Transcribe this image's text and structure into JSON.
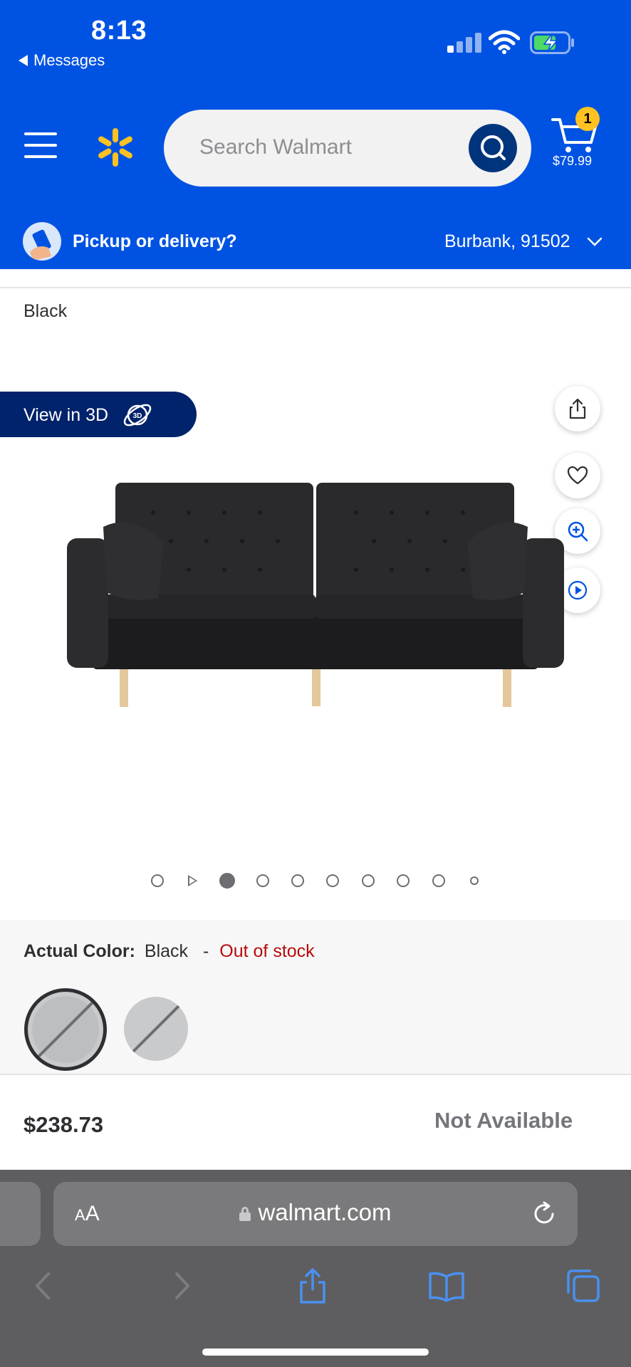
{
  "status_bar": {
    "time": "8:13",
    "back_label": "Messages"
  },
  "header": {
    "search_placeholder": "Search Walmart",
    "cart_count": "1",
    "cart_total": "$79.99",
    "pickup_label": "Pickup or delivery?",
    "location": "Burbank, 91502"
  },
  "product": {
    "color_name": "Black",
    "view_3d_label": "View in 3D",
    "image_count": 10,
    "active_image_index": 2
  },
  "variant": {
    "actual_color_label": "Actual Color:",
    "actual_color_value": "Black",
    "separator": "-",
    "stock_status": "Out of stock"
  },
  "purchase": {
    "price": "$238.73",
    "availability": "Not Available"
  },
  "browser": {
    "text_size_small": "A",
    "text_size_large": "A",
    "url": "walmart.com"
  },
  "colors": {
    "walmart_blue": "#0053e2",
    "spark_yellow": "#ffc220",
    "out_of_stock_red": "#b80b0b",
    "dark_navy": "#00236b"
  },
  "icons": [
    "hamburger-menu-icon",
    "walmart-spark-logo",
    "search-icon",
    "cart-icon",
    "share-icon",
    "heart-icon",
    "zoom-in-icon",
    "play-video-icon",
    "3d-icon",
    "lock-icon",
    "reload-icon",
    "back-icon",
    "forward-icon",
    "share-icon",
    "bookmarks-icon",
    "tabs-icon"
  ]
}
